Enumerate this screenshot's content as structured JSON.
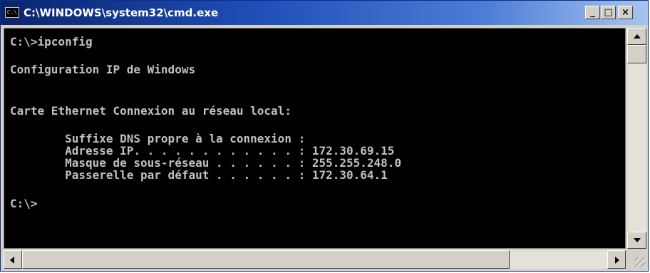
{
  "window": {
    "title": "C:\\WINDOWS\\system32\\cmd.exe",
    "icon": "cmd-icon",
    "minimize_label": "_",
    "maximize_label": "□",
    "close_label": "×"
  },
  "console": {
    "lines": [
      "C:\\>ipconfig",
      "Configuration IP de Windows",
      "Carte Ethernet Connexion au réseau local:",
      "        Suffixe DNS propre à la connexion :",
      "        Adresse IP. . . . . . . . . . . . : 172.30.69.15",
      "        Masque de sous-réseau . . . . . . : 255.255.248.0",
      "        Passerelle par défaut . . . . . . : 172.30.64.1",
      "C:\\>"
    ]
  },
  "colors": {
    "console_bg": "#000000",
    "console_text": "#c0c0c0",
    "titlebar_start": "#0a246a",
    "titlebar_end": "#a6c4ee"
  }
}
